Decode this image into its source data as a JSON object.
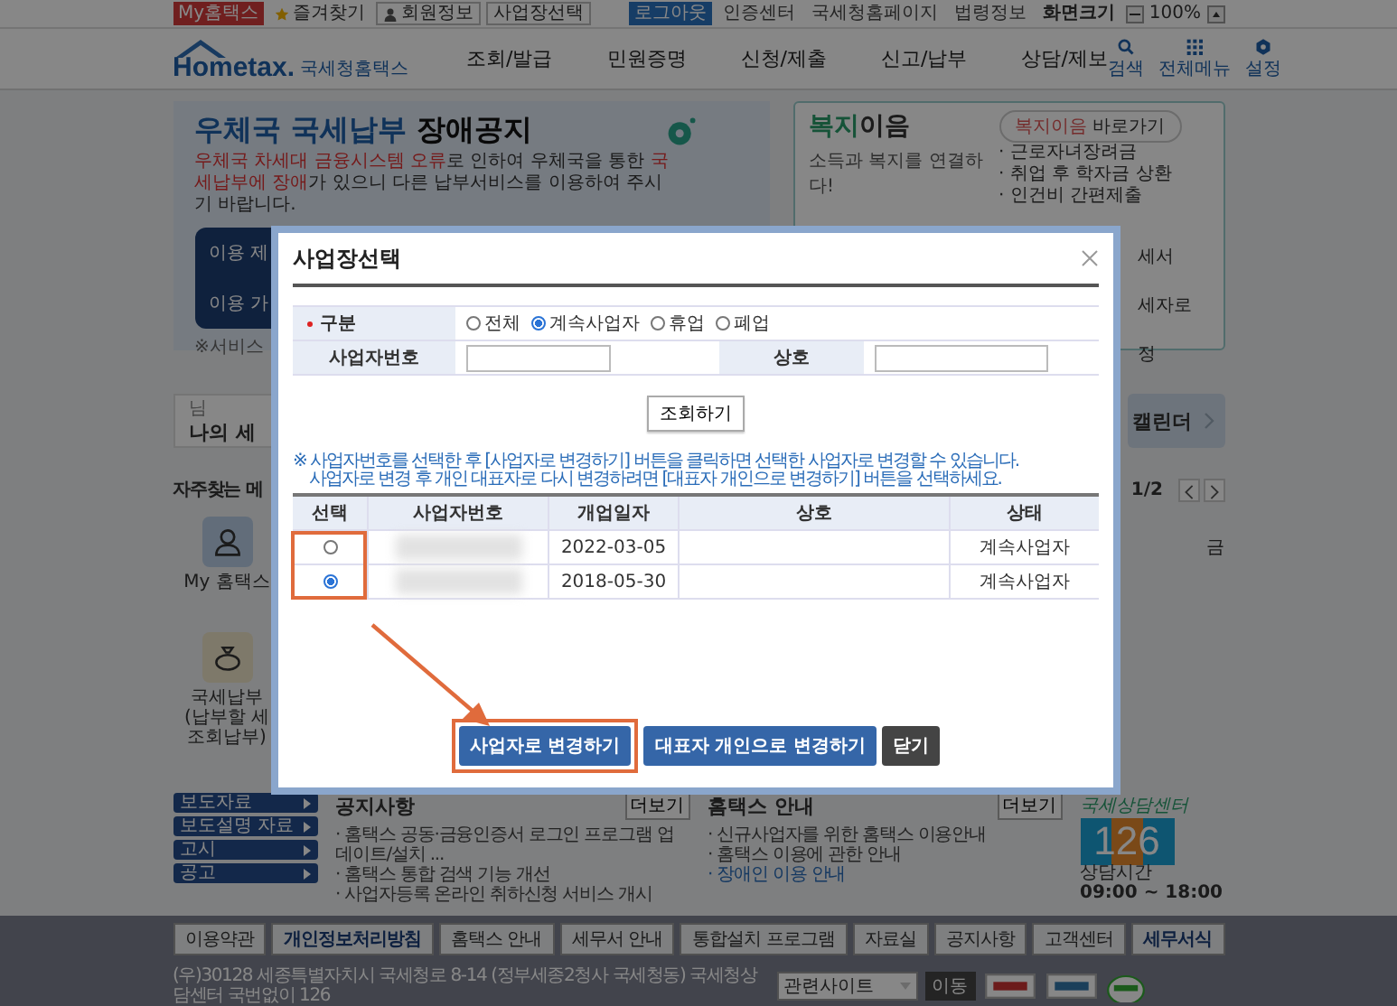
{
  "top_bar": {
    "left": [
      {
        "label": "My홈택스",
        "kind": "accent"
      },
      {
        "label": "즐겨찾기",
        "kind": "star"
      },
      {
        "label": "회원정보",
        "kind": "person"
      },
      {
        "label": "사업장선택",
        "kind": "plain"
      }
    ],
    "right": [
      {
        "label": "로그아웃",
        "kind": "accent"
      },
      {
        "label": "인증센터",
        "kind": "link"
      },
      {
        "label": "국세청홈페이지",
        "kind": "link"
      },
      {
        "label": "법령정보",
        "kind": "link"
      },
      {
        "label": "화면크기",
        "kind": "bold"
      }
    ],
    "zoom": "100%"
  },
  "header": {
    "logo": "Hometax.",
    "logo_sub": "국세청홈택스",
    "menu": [
      "조회/발급",
      "민원증명",
      "신청/제출",
      "신고/납부",
      "상담/제보"
    ],
    "tools": [
      {
        "label": "검색",
        "kind": "search"
      },
      {
        "label": "전체메뉴",
        "kind": "grid"
      },
      {
        "label": "설정",
        "kind": "gear"
      }
    ]
  },
  "notice_banner": {
    "title": [
      {
        "text": "우체국 국세납부",
        "highlight": true
      },
      {
        "text": " 장애공지",
        "highlight": false
      }
    ],
    "body": [
      {
        "text": "우체국 차세대 금융시스템 오류",
        "highlight": true
      },
      {
        "text": "로 인하여 우체국을 통한 ",
        "highlight": false
      },
      {
        "text": "국세납부에 장애",
        "highlight": true
      },
      {
        "text": "가 있으니 다른 납부서비스를 이용하여 주시기 바랍니다.",
        "highlight": false
      }
    ],
    "rows": [
      "이용 제",
      "이용 가"
    ],
    "note": "※서비스"
  },
  "welfare_box": {
    "title_highlight": "복지",
    "title_rest": "이음",
    "subtitle": "소득과 복지를 연결하다!",
    "link_highlight": "복지이음",
    "link_rest": " 바로가기",
    "items": [
      "· 근로자녀장려금",
      "· 취업 후 학자금 상환",
      "· 인건비 간편제출"
    ],
    "fragments": [
      "세서",
      "세자로",
      "정"
    ]
  },
  "user_card": {
    "greeting": "님",
    "title": "나의 세"
  },
  "calendar_card": {
    "label": "캘린더"
  },
  "frequent": {
    "title": "자주찾는 메",
    "page": "1/2",
    "items": [
      {
        "label": "My 홈택스",
        "kind": "person"
      },
      {
        "label": "국세납부\n(납부할 세\n조회납부)",
        "kind": "money"
      }
    ],
    "fragments": [
      "금"
    ]
  },
  "dialog": {
    "title": "사업장선택",
    "filter": {
      "label": "구분",
      "options": [
        {
          "label": "전체",
          "selected": false
        },
        {
          "label": "계속사업자",
          "selected": true
        },
        {
          "label": "휴업",
          "selected": false
        },
        {
          "label": "폐업",
          "selected": false
        }
      ],
      "number_label": "사업자번호",
      "name_label": "상호",
      "search_button": "조회하기"
    },
    "notice": [
      "※ 사업자번호를 선택한 후 [사업자로 변경하기] 버튼을 클릭하면 선택한 사업자로 변경할 수 있습니다.",
      "사업자로 변경 후 개인 대표자로 다시 변경하려면 [대표자 개인으로 변경하기] 버튼을 선택하세요."
    ],
    "table": {
      "columns": [
        "선택",
        "사업자번호",
        "개업일자",
        "상호",
        "상태"
      ],
      "highlight_select_column": true,
      "rows": [
        {
          "selected": false,
          "opened": "2022-03-05",
          "status": "계속사업자"
        },
        {
          "selected": true,
          "opened": "2018-05-30",
          "status": "계속사업자"
        }
      ]
    },
    "arrow": true,
    "buttons": [
      {
        "label": "사업자로 변경하기",
        "kind": "primary",
        "highlighted": true
      },
      {
        "label": "대표자 개인으로 변경하기",
        "kind": "primary",
        "highlighted": false
      },
      {
        "label": "닫기",
        "kind": "dark",
        "highlighted": false
      }
    ]
  },
  "bottom": {
    "side_links": [
      "보도자료",
      "보도설명 자료",
      "고시",
      "공고"
    ],
    "notices": {
      "title": "공지사항",
      "more": "더보기",
      "items": [
        {
          "text": "· 홈택스 공동·금융인증서 로그인 프로그램 업데이트/설치 ...",
          "link": false
        },
        {
          "text": "· 홈택스 통합 검색 기능 개선",
          "link": false
        },
        {
          "text": "· 사업자등록 온라인 취하신청 서비스 개시",
          "link": false
        }
      ]
    },
    "guide": {
      "title": "홈택스 안내",
      "more": "더보기",
      "items": [
        {
          "text": "· 신규사업자를 위한 홈택스 이용안내",
          "link": false
        },
        {
          "text": "· 홈택스 이용에 관한 안내",
          "link": false
        },
        {
          "text": "· 장애인 이용 안내",
          "link": true
        }
      ]
    },
    "center": {
      "caption": "국세상담센터",
      "number": "126",
      "hours_label": "상담시간",
      "hours": "09:00 ~ 18:00"
    }
  },
  "footer": {
    "links": [
      {
        "label": "이용약관",
        "bold": false
      },
      {
        "label": "개인정보처리방침",
        "bold": true
      },
      {
        "label": "홈택스 안내",
        "bold": false
      },
      {
        "label": "세무서 안내",
        "bold": false
      },
      {
        "label": "통합설치 프로그램",
        "bold": false
      },
      {
        "label": "자료실",
        "bold": false
      },
      {
        "label": "공지사항",
        "bold": false
      },
      {
        "label": "고객센터",
        "bold": false
      },
      {
        "label": "세무서식",
        "bold": true
      }
    ],
    "address": "(우)30128 세종특별자치시 국세청로 8-14 (정부세종2청사 국세청동) 국세청상담센터 국번없이 126",
    "related": "관련사이트",
    "go": "이동"
  }
}
